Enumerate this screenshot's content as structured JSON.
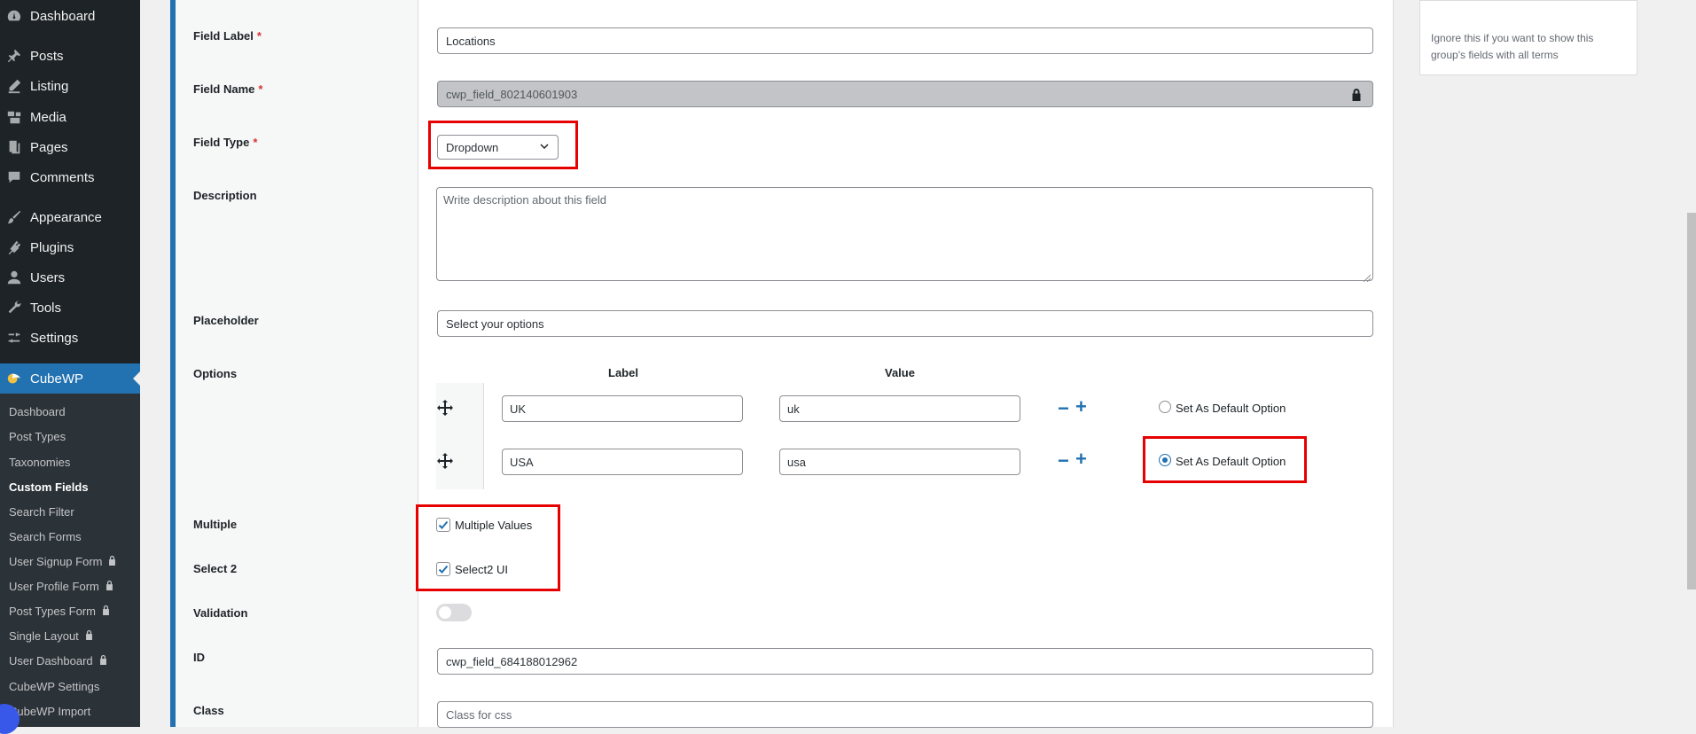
{
  "sidebar": {
    "top_menu": [
      {
        "label": "Dashboard",
        "icon": "dashboard-icon"
      },
      {
        "label": "Posts",
        "icon": "pin-icon"
      },
      {
        "label": "Listing",
        "icon": "edit-icon"
      },
      {
        "label": "Media",
        "icon": "media-icon"
      },
      {
        "label": "Pages",
        "icon": "pages-icon"
      },
      {
        "label": "Comments",
        "icon": "comment-icon"
      },
      {
        "label": "Appearance",
        "icon": "brush-icon"
      },
      {
        "label": "Plugins",
        "icon": "plugin-icon"
      },
      {
        "label": "Users",
        "icon": "user-icon"
      },
      {
        "label": "Tools",
        "icon": "wrench-icon"
      },
      {
        "label": "Settings",
        "icon": "settings-icon"
      }
    ],
    "current_menu": {
      "label": "CubeWP",
      "icon": "cubewp-logo-icon"
    },
    "submenu": [
      {
        "label": "Dashboard",
        "locked": false
      },
      {
        "label": "Post Types",
        "locked": false
      },
      {
        "label": "Taxonomies",
        "locked": false
      },
      {
        "label": "Custom Fields",
        "locked": false,
        "current": true
      },
      {
        "label": "Search Filter",
        "locked": false
      },
      {
        "label": "Search Forms",
        "locked": false
      },
      {
        "label": "User Signup Form",
        "locked": true
      },
      {
        "label": "User Profile Form",
        "locked": true
      },
      {
        "label": "Post Types Form",
        "locked": true
      },
      {
        "label": "Single Layout",
        "locked": true
      },
      {
        "label": "User Dashboard",
        "locked": true
      },
      {
        "label": "CubeWP Settings",
        "locked": false
      },
      {
        "label": "CubeWP Import",
        "locked": false
      }
    ]
  },
  "form": {
    "field_label": {
      "label": "Field Label",
      "required": "*",
      "value": "Locations"
    },
    "field_name": {
      "label": "Field Name",
      "required": "*",
      "value": "cwp_field_802140601903"
    },
    "field_type": {
      "label": "Field Type",
      "required": "*",
      "value": "Dropdown"
    },
    "description": {
      "label": "Description",
      "placeholder": "Write description about this field"
    },
    "placeholder": {
      "label": "Placeholder",
      "value": "Select your options"
    },
    "options": {
      "label": "Options",
      "col_label": "Label",
      "col_value": "Value",
      "rows": [
        {
          "label": "UK",
          "value": "uk",
          "default_label": "Set As Default Option",
          "is_default": false
        },
        {
          "label": "USA",
          "value": "usa",
          "default_label": "Set As Default Option",
          "is_default": true
        }
      ],
      "minus": "−",
      "plus": "+"
    },
    "multiple": {
      "label": "Multiple",
      "checkbox_label": "Multiple Values",
      "checked": true
    },
    "select2": {
      "label": "Select 2",
      "checkbox_label": "Select2 UI",
      "checked": true
    },
    "validation": {
      "label": "Validation",
      "enabled": false
    },
    "id": {
      "label": "ID",
      "value": "cwp_field_684188012962"
    },
    "class": {
      "label": "Class",
      "placeholder": "Class for css"
    }
  },
  "right_panel": {
    "hint": "Ignore this if you want to show this group's fields with all terms"
  },
  "colors": {
    "accent": "#2271b1",
    "highlight": "#e60000",
    "sidebar_bg": "#1d2327"
  }
}
